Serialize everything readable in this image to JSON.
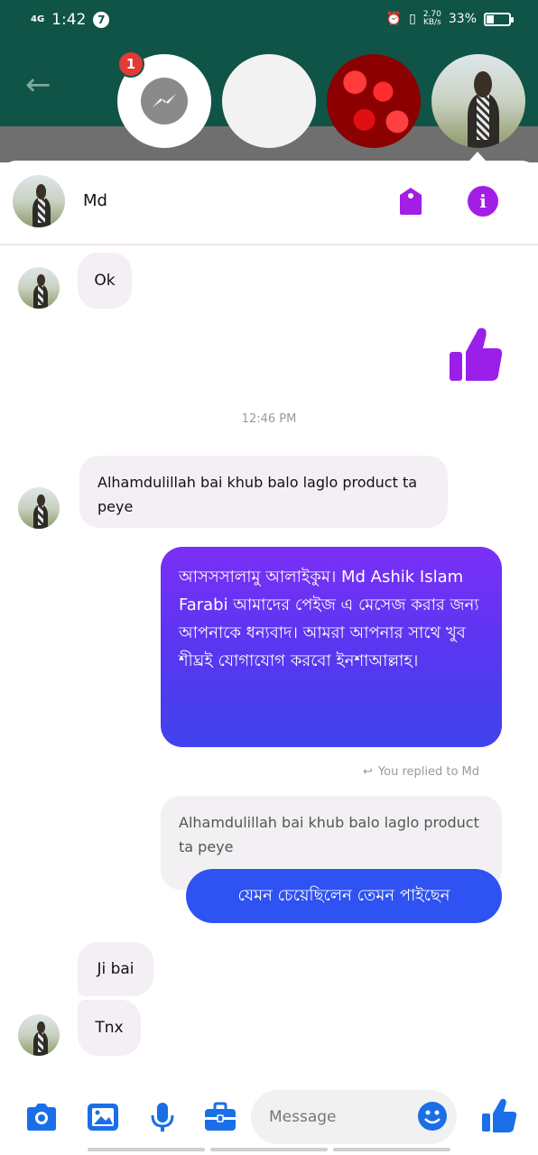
{
  "status_bar": {
    "network": "4G",
    "time": "1:42",
    "notification_count": "7",
    "speed_value": "2.70",
    "speed_unit": "KB/s",
    "battery": "33%",
    "battery_level": 0.33
  },
  "chat_heads": {
    "messenger_badge": "1"
  },
  "conversation": {
    "contact_name": "Md",
    "messages": [
      {
        "id": "m1",
        "direction": "incoming",
        "text": "Ok"
      },
      {
        "id": "m2",
        "direction": "outgoing",
        "type": "like"
      },
      {
        "id": "m3",
        "type": "timestamp",
        "text": "12:46 PM"
      },
      {
        "id": "m4",
        "direction": "incoming",
        "text": "Alhamdulillah bai khub balo laglo product ta peye"
      },
      {
        "id": "m5",
        "direction": "outgoing",
        "text": "আসসসালামু আলাইকুম। Md Ashik Islam Farabi  আমাদের পেইজ এ মেসেজ করার জন্য আপনাকে ধন্যবাদ। আমরা আপনার সাথে খুব শীঘ্রই যোগাযোগ করবো ইনশাআল্লাহ।"
      },
      {
        "id": "m6",
        "type": "reply_note",
        "text": "You replied to Md"
      },
      {
        "id": "m7",
        "type": "quoted",
        "text": "Alhamdulillah bai khub balo laglo product ta peye"
      },
      {
        "id": "m8",
        "direction": "outgoing",
        "text": "যেমন চেয়েছিলেন তেমন পাইছেন"
      },
      {
        "id": "m9",
        "direction": "incoming",
        "text": "Ji bai"
      },
      {
        "id": "m10",
        "direction": "incoming",
        "text": "Tnx"
      }
    ]
  },
  "composer": {
    "placeholder": "Message",
    "icons": [
      "camera-icon",
      "gallery-icon",
      "microphone-icon",
      "briefcase-icon",
      "emoji-icon",
      "like-icon"
    ]
  },
  "colors": {
    "accent": "#a21ee6",
    "composer_icon": "#1a6fe8",
    "outgoing_gradient_top": "#7b2ff7",
    "outgoing_gradient_bottom": "#3f43ee",
    "reply_bubble": "#2f52f2",
    "header_bg": "#0f5446"
  }
}
